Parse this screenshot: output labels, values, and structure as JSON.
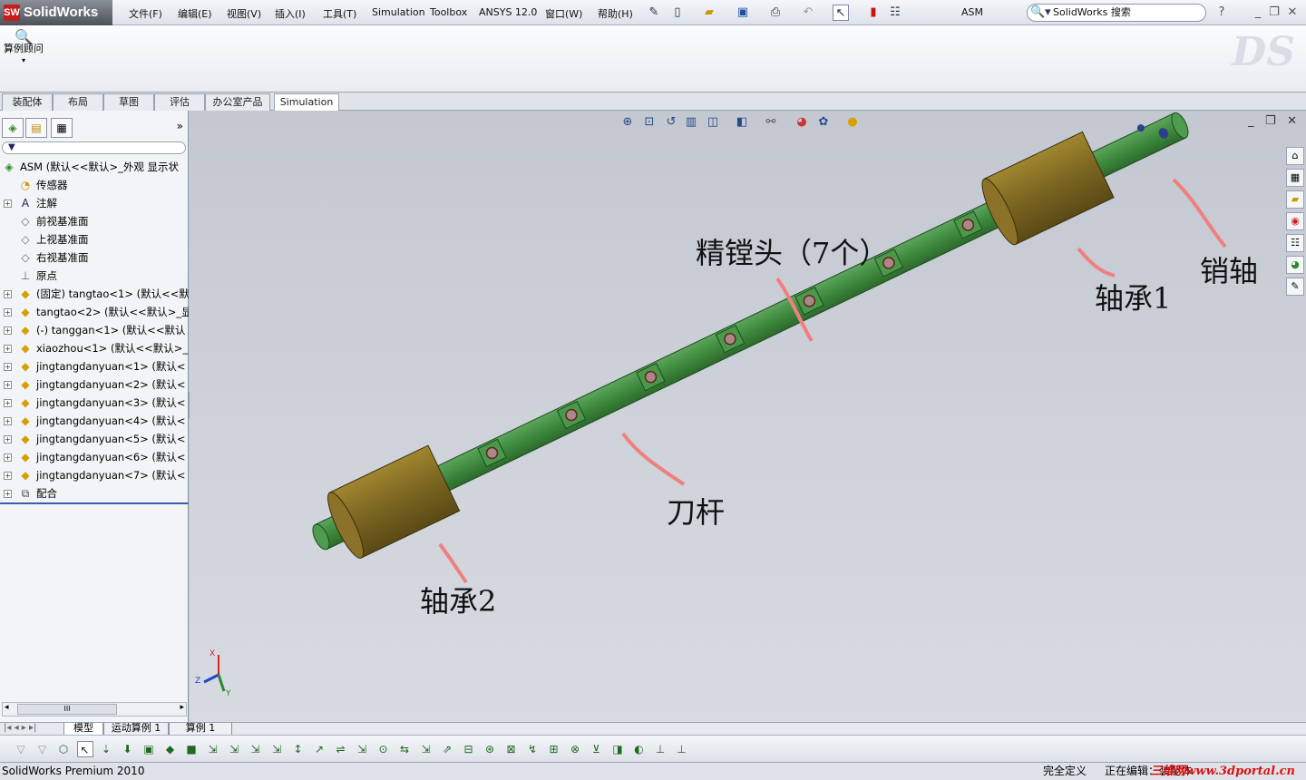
{
  "app": {
    "logo": "SolidWorks",
    "logo_mark": "SW",
    "doc_name": "ASM"
  },
  "menu": [
    "文件(F)",
    "编辑(E)",
    "视图(V)",
    "插入(I)",
    "工具(T)",
    "Simulation",
    "Toolbox",
    "ANSYS 12.0",
    "窗口(W)",
    "帮助(H)"
  ],
  "search": {
    "placeholder": "SolidWorks 搜索",
    "help": "?"
  },
  "command_manager": {
    "study_button": "算例顾问"
  },
  "tabs": [
    "装配体",
    "布局",
    "草图",
    "评估",
    "办公室产品",
    "Simulation"
  ],
  "active_tab": "Simulation",
  "feature_tree": {
    "filter": "▼",
    "collapse": "»",
    "nodes": [
      {
        "label": "ASM  (默认<<默认>_外观 显示状",
        "icon": "assembly-icon"
      },
      {
        "label": "传感器",
        "icon": "sensor-icon"
      },
      {
        "label": "注解",
        "icon": "annotation-icon"
      },
      {
        "label": "前视基准面",
        "icon": "plane-icon"
      },
      {
        "label": "上视基准面",
        "icon": "plane-icon"
      },
      {
        "label": "右视基准面",
        "icon": "plane-icon"
      },
      {
        "label": "原点",
        "icon": "origin-icon"
      },
      {
        "label": "(固定) tangtao<1> (默认<<默",
        "icon": "part-icon"
      },
      {
        "label": "tangtao<2> (默认<<默认>_显",
        "icon": "part-icon"
      },
      {
        "label": "(-) tanggan<1> (默认<<默认",
        "icon": "part-icon"
      },
      {
        "label": "xiaozhou<1> (默认<<默认>_",
        "icon": "part-icon"
      },
      {
        "label": "jingtangdanyuan<1> (默认<",
        "icon": "part-icon"
      },
      {
        "label": "jingtangdanyuan<2> (默认<",
        "icon": "part-icon"
      },
      {
        "label": "jingtangdanyuan<3> (默认<",
        "icon": "part-icon"
      },
      {
        "label": "jingtangdanyuan<4> (默认<",
        "icon": "part-icon"
      },
      {
        "label": "jingtangdanyuan<5> (默认<",
        "icon": "part-icon"
      },
      {
        "label": "jingtangdanyuan<6> (默认<",
        "icon": "part-icon"
      },
      {
        "label": "jingtangdanyuan<7> (默认<",
        "icon": "part-icon"
      },
      {
        "label": "配合",
        "icon": "mates-icon"
      }
    ]
  },
  "scrollbar_thumb": "III",
  "callouts": {
    "boring_heads": "精镗头（7个）",
    "bearing1": "轴承1",
    "pin": "销轴",
    "bar": "刀杆",
    "bearing2": "轴承2"
  },
  "triad": {
    "x": "X",
    "y": "Y",
    "z": "Z"
  },
  "sheet_tabs": [
    "模型",
    "运动算例 1",
    "算例 1"
  ],
  "status": {
    "product": "SolidWorks Premium 2010",
    "state": "完全定义",
    "mode": "正在编辑：装配体"
  },
  "watermark": "三维网www.3dportal.cn",
  "colors": {
    "shaft": "#3e8a3e",
    "bearing": "#7a6420",
    "callout_line": "#f08080"
  }
}
